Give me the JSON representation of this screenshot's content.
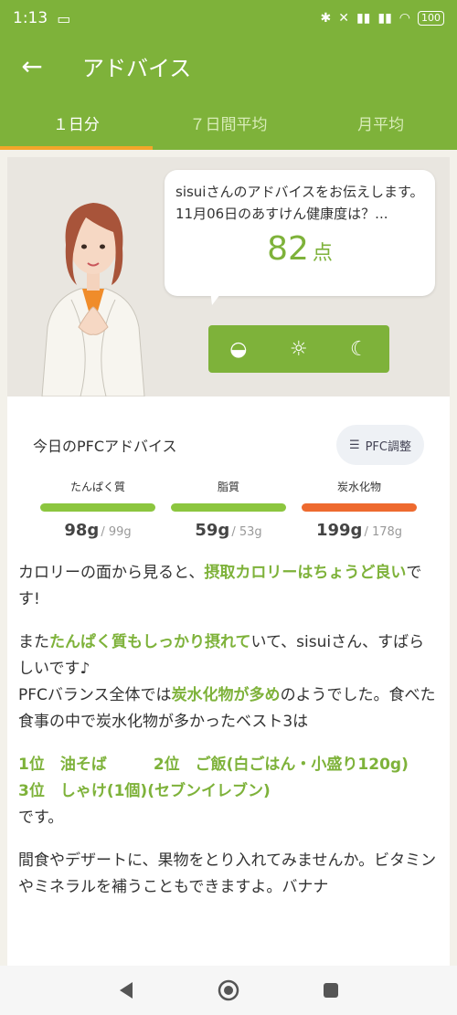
{
  "status": {
    "time": "1:13",
    "battery": "100"
  },
  "appbar": {
    "title": "アドバイス"
  },
  "tabs": [
    {
      "label": "１日分"
    },
    {
      "label": "７日間平均"
    },
    {
      "label": "月平均"
    }
  ],
  "bubble": {
    "text": "sisuiさんのアドバイスをお伝えします。11月06日のあすけん健康度は？...",
    "score": "82",
    "score_unit": "点"
  },
  "pfc": {
    "title": "今日のPFCアドバイス",
    "adjust_label": "PFC調整",
    "items": [
      {
        "label": "たんぱく質",
        "value": "98g",
        "target": "/ 99g",
        "color": "#8cc63f"
      },
      {
        "label": "脂質",
        "value": "59g",
        "target": "/ 53g",
        "color": "#8cc63f"
      },
      {
        "label": "炭水化物",
        "value": "199g",
        "target": "/ 178g",
        "color": "#ee6a2f"
      }
    ]
  },
  "advice": {
    "p1_a": "カロリーの面から見ると、",
    "p1_b": "摂取カロリーはちょうど良い",
    "p1_c": "です!",
    "p2_a": "また",
    "p2_b": "たんぱく質もしっかり摂れて",
    "p2_c": "いて、sisuiさん、すばらしいです♪",
    "p2_d": "PFCバランス全体では",
    "p2_e": "炭水化物が多め",
    "p2_f": "のようでした。食べた食事の中で炭水化物が多かったベスト3は",
    "p3_a": "1位　油そば　　　2位　ご飯(白ごはん・小盛り120g)　　　3位　しゃけ(1個)(セブンイレブン)",
    "p3_b": "です。",
    "p4": "間食やデザートに、果物をとり入れてみませんか。ビタミンやミネラルを補うこともできますよ。バナナ"
  },
  "colors": {
    "accent": "#7eb23a",
    "tab_indicator": "#f3a629",
    "carb_bar": "#ee6a2f"
  }
}
